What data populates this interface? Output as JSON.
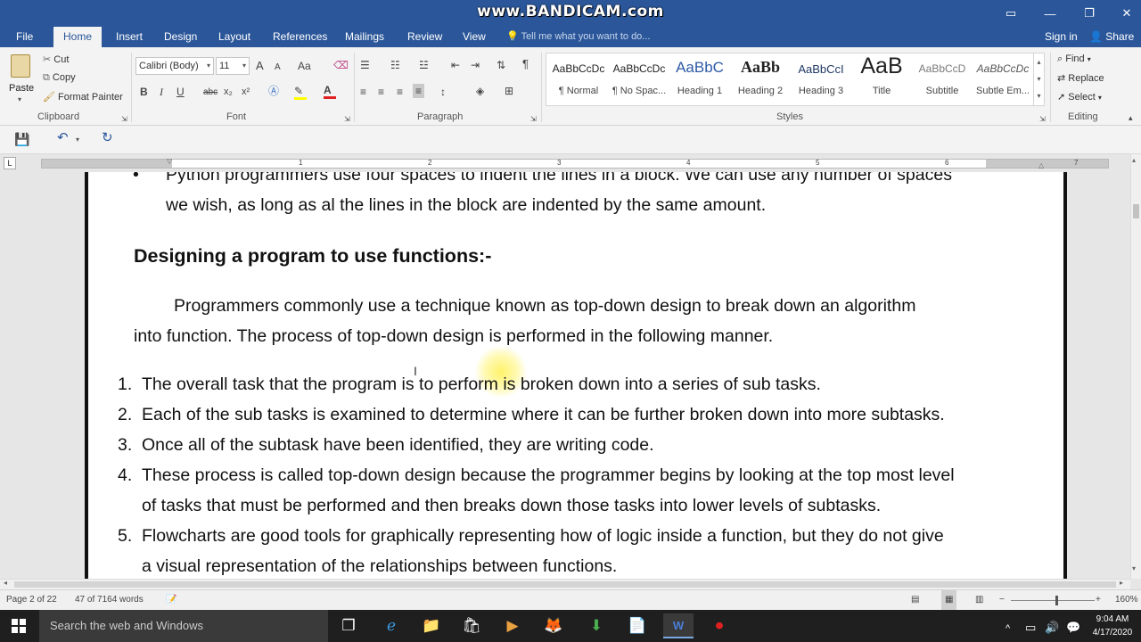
{
  "titlebar": {
    "watermark": "www.BANDICAM.com",
    "controls": [
      "▭",
      "—",
      "❐",
      "✕"
    ]
  },
  "menu": {
    "tabs": [
      "File",
      "Home",
      "Insert",
      "Design",
      "Layout",
      "References",
      "Mailings",
      "Review",
      "View"
    ],
    "tell_me": "Tell me what you want to do...",
    "sign_in": "Sign in",
    "share": "Share"
  },
  "ribbon": {
    "clipboard": {
      "paste": "Paste",
      "cut": "Cut",
      "copy": "Copy",
      "format_painter": "Format Painter",
      "label": "Clipboard"
    },
    "font": {
      "name": "Calibri (Body)",
      "size": "11",
      "label": "Font",
      "bold": "B",
      "italic": "I",
      "underline": "U",
      "strike": "abc",
      "sub": "x₂",
      "sup": "x²",
      "grow": "A",
      "shrink": "A",
      "case": "Aa",
      "color": "A"
    },
    "paragraph": {
      "label": "Paragraph",
      "pilcrow": "¶"
    },
    "styles": {
      "label": "Styles",
      "items": [
        {
          "sample": "AaBbCcDc",
          "name": "¶ Normal"
        },
        {
          "sample": "AaBbCcDc",
          "name": "¶ No Spac..."
        },
        {
          "sample": "AaBbC",
          "name": "Heading 1"
        },
        {
          "sample": "AaBb",
          "name": "Heading 2"
        },
        {
          "sample": "AaBbCcI",
          "name": "Heading 3"
        },
        {
          "sample": "AaB",
          "name": "Title"
        },
        {
          "sample": "AaBbCcD",
          "name": "Subtitle"
        },
        {
          "sample": "AaBbCcDc",
          "name": "Subtle Em..."
        }
      ]
    },
    "editing": {
      "label": "Editing",
      "find": "Find",
      "replace": "Replace",
      "select": "Select"
    }
  },
  "document": {
    "bullet_line1": "Python programmers use four spaces to indent the lines in a block. We can use any number of spaces",
    "bullet_line2": "we wish, as long as al the lines in the block are indented by the same amount.",
    "heading": "Designing a program to use functions:-",
    "para_line1": "Programmers commonly use a technique known as top-down design to break down an algorithm",
    "para_line2": "into function. The process of top-down design is performed in the following manner.",
    "list": [
      {
        "num": "1.",
        "lines": [
          "The overall task that the program is to perform is broken down into a series of sub tasks."
        ]
      },
      {
        "num": "2.",
        "lines": [
          "Each of the sub tasks is examined to determine where it can be further broken down into more subtasks."
        ]
      },
      {
        "num": "3.",
        "lines": [
          "Once all of the subtask have been identified, they are writing code."
        ]
      },
      {
        "num": "4.",
        "lines": [
          "These process is called top-down design because the programmer begins by looking at the top most level",
          "of tasks that must be performed and then breaks down those tasks into lower levels of subtasks."
        ]
      },
      {
        "num": "5.",
        "lines": [
          "Flowcharts are good tools for graphically representing how of logic inside a function, but they do not give",
          "a visual representation of the relationships between functions."
        ]
      }
    ]
  },
  "ruler": {
    "numbers": [
      "1",
      "2",
      "3",
      "4",
      "5",
      "6",
      "7"
    ]
  },
  "status": {
    "page": "Page 2 of 22",
    "words": "47 of 7164 words",
    "zoom": "160%"
  },
  "taskbar": {
    "search_placeholder": "Search the web and Windows",
    "time": "9:04 AM",
    "date": "4/17/2020"
  },
  "colors": {
    "accent": "#2b579a"
  }
}
